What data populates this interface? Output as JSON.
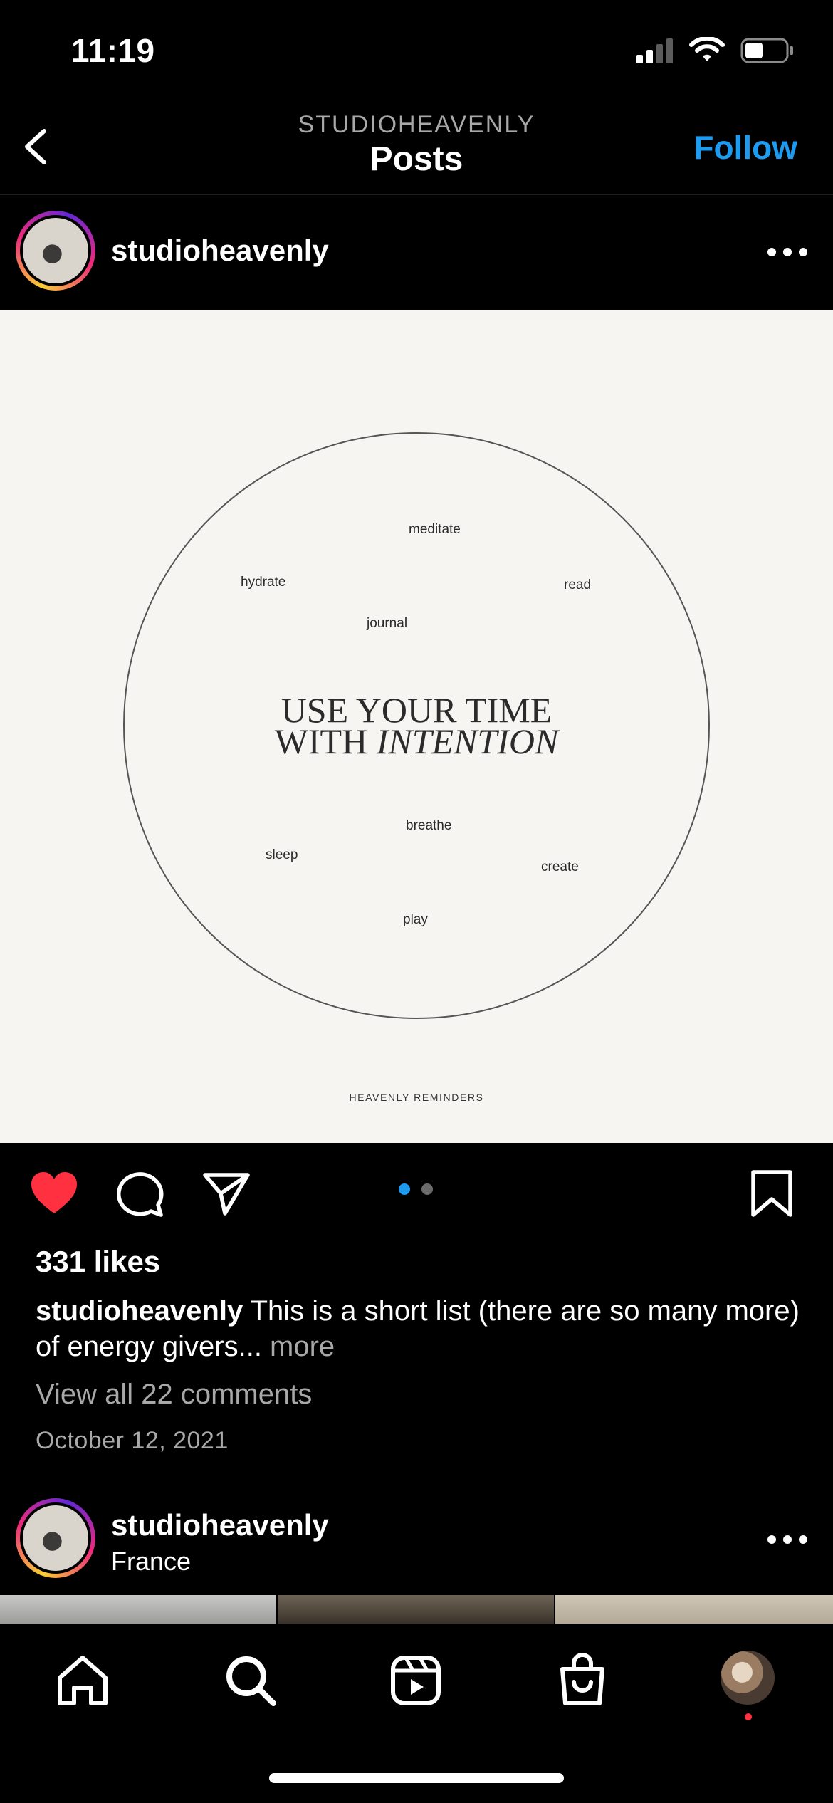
{
  "status_bar": {
    "time": "11:19"
  },
  "header": {
    "account": "STUDIOHEAVENLY",
    "title": "Posts",
    "follow": "Follow"
  },
  "post": {
    "username": "studioheavenly",
    "image": {
      "words": [
        "meditate",
        "hydrate",
        "read",
        "journal",
        "breathe",
        "sleep",
        "create",
        "play"
      ],
      "center_line1": "USE YOUR TIME",
      "center_line2_a": "WITH ",
      "center_line2_b": "INTENTION",
      "footer": "HEAVENLY REMINDERS"
    },
    "carousel": {
      "count": 2,
      "active": 1
    },
    "liked": true,
    "likes": "331 likes",
    "caption_user": "studioheavenly",
    "caption_text": " This is a short list (there are so many more) of energy givers... ",
    "caption_more": "more",
    "comments": "View all 22 comments",
    "date": "October 12, 2021"
  },
  "next_post": {
    "username": "studioheavenly",
    "location": "France"
  },
  "tab_bar": {
    "items": [
      "home-icon",
      "search-icon",
      "reels-icon",
      "shop-icon",
      "profile-avatar"
    ],
    "profile_notification": true
  },
  "colors": {
    "accent": "#1d9bf0",
    "like": "#ff3040",
    "background": "#000000",
    "muted": "#a8a8a8"
  }
}
